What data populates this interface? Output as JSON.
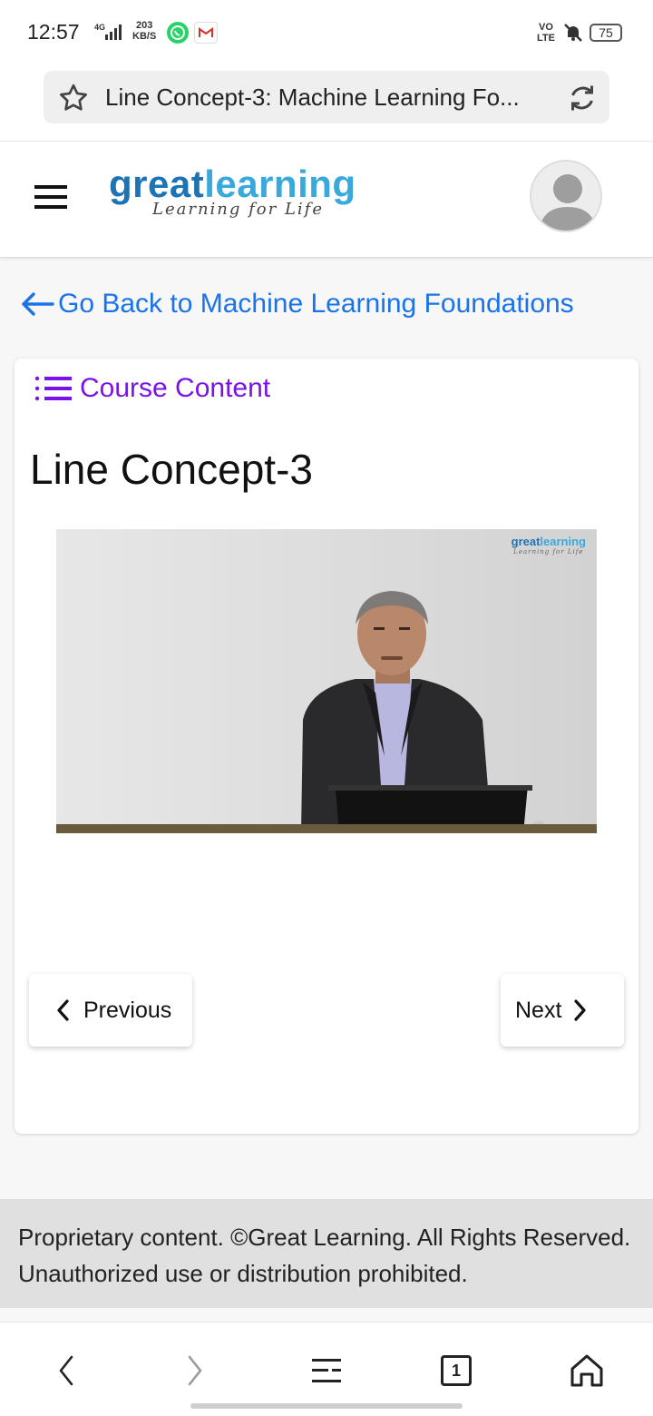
{
  "status_bar": {
    "time": "12:57",
    "network": "4G",
    "speed_value": "203",
    "speed_unit": "KB/S",
    "volte_top": "VO",
    "volte_bottom": "LTE",
    "battery": "75"
  },
  "browser": {
    "page_title": "Line Concept-3: Machine Learning Fo..."
  },
  "header": {
    "logo_great": "great",
    "logo_learning": "learning",
    "logo_tagline": "Learning for Life"
  },
  "back_link": {
    "label": "Go Back to Machine Learning Foundations"
  },
  "card": {
    "course_content_label": "Course Content",
    "lesson_title": "Line Concept-3",
    "video_logo_great": "great",
    "video_logo_learning": "learning",
    "video_logo_tagline": "Learning for Life",
    "prev_label": "Previous",
    "next_label": "Next"
  },
  "footer": {
    "text": "Proprietary content. ©Great Learning. All Rights Reserved. Unauthorized use or distribution prohibited."
  },
  "bottom_nav": {
    "tab_count": "1"
  },
  "colors": {
    "link_blue": "#1a73e8",
    "course_purple": "#7a14e6",
    "logo_dark_blue": "#1d74b5",
    "logo_light_blue": "#39a9dc"
  }
}
